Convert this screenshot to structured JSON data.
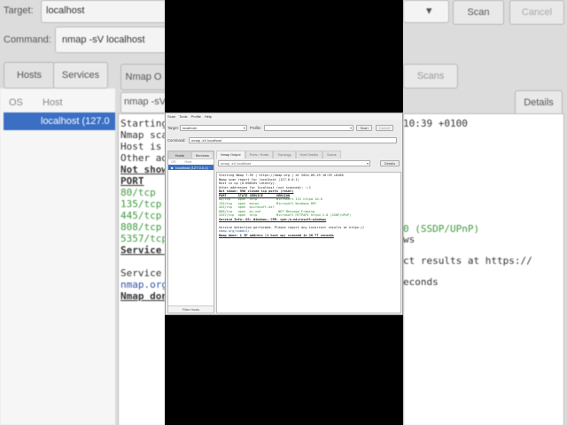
{
  "menu": [
    "Scan",
    "Tools",
    "Profile",
    "Help"
  ],
  "target": {
    "label": "Target:",
    "value": "localhost"
  },
  "profile": {
    "label": "Profile:",
    "value": ""
  },
  "command": {
    "label": "Command:",
    "value": "nmap -sV localhost"
  },
  "buttons": {
    "scan": "Scan",
    "cancel": "Cancel",
    "details": "Details"
  },
  "left_tabs": [
    "Hosts",
    "Services"
  ],
  "host_columns": [
    "OS",
    "Host"
  ],
  "host_entry": "localhost (127.0.0.1)",
  "filter_hosts": "Filter Hosts",
  "right_tabs": [
    "Nmap Output",
    "Ports / Hosts",
    "Topology",
    "Host Details",
    "Scans"
  ],
  "output_select": "nmap -sV localhost",
  "output_lines": [
    {
      "t": "Starting Nmap 7.95 ( https://nmap.org ) at 2024-09-29 10:39 +0100",
      "c": ""
    },
    {
      "t": "Nmap scan report for localhost (127.0.0.1)",
      "c": ""
    },
    {
      "t": "Host is up (0.00016s latency).",
      "c": ""
    },
    {
      "t": "Other addresses for localhost (not scanned): ::1",
      "c": ""
    },
    {
      "t": "Not shown: 996 closed tcp ports (reset)",
      "c": "b"
    },
    {
      "t": "PORT      STATE SERVICE       VERSION",
      "c": "b"
    },
    {
      "t": "80/tcp    open  http          Microsoft IIS httpd 10.0",
      "c": "green"
    },
    {
      "t": "135/tcp   open  msrpc         Microsoft Windows RPC",
      "c": "green"
    },
    {
      "t": "445/tcp   open  microsoft-ds?",
      "c": "green"
    },
    {
      "t": "808/tcp   open  mc-nmf        .NET Message Framing",
      "c": "green"
    },
    {
      "t": "5357/tcp  open  http          Microsoft HTTPAPI httpd 2.0 (SSDP/UPnP)",
      "c": "green"
    },
    {
      "t": "Service Info: OS: Windows; CPE: cpe:/o:microsoft:windows",
      "c": "b"
    },
    {
      "t": "",
      "c": ""
    },
    {
      "t": "Service detection performed. Please report any incorrect results at https://",
      "c": ""
    },
    {
      "t": "nmap.org/submit/ .",
      "c": "blue"
    },
    {
      "t": "Nmap done: 1 IP address (1 host up) scanned in 20.77 seconds",
      "c": "b"
    }
  ],
  "bg": {
    "target_label": "Target:",
    "target_value": "localhost",
    "command_label": "Command:",
    "command_value": "nmap -sV localhost",
    "hosts_tab": "Hosts",
    "services_tab": "Services",
    "os_col": "OS",
    "host_col": "Host",
    "host_entry": "localhost (127.0",
    "nmap_tab": "Nmap O",
    "select_value": "nmap -sV lo",
    "scan_btn": "Scan",
    "cancel_btn": "Cancel",
    "scans_tab": "Scans",
    "details_btn": "Details",
    "right_time": "10:39 +0100",
    "right_ssdp": "0 (SSDP/UPnP)",
    "right_ws": "ws",
    "right_results": "ct results at https://",
    "right_seconds": "econds"
  }
}
